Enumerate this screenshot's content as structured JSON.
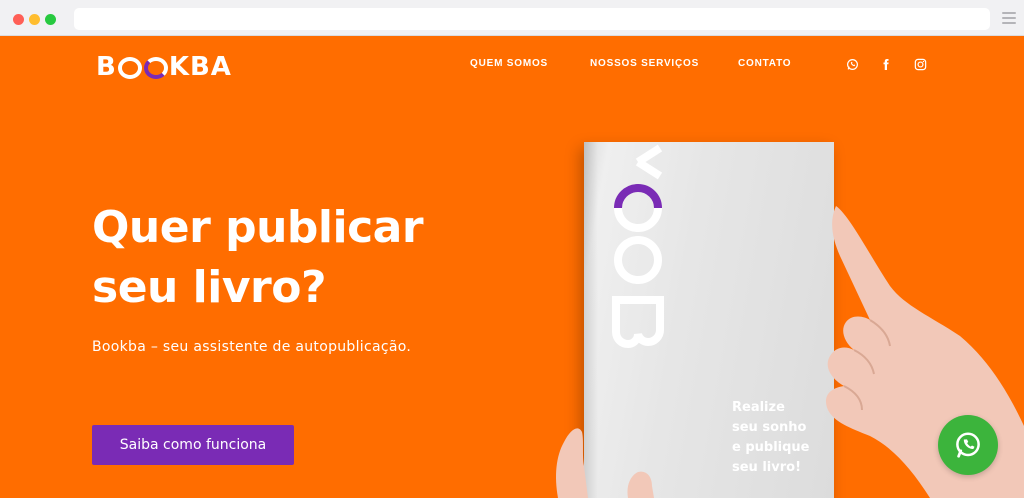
{
  "browser": {
    "url": ""
  },
  "header": {
    "logo_text": "BOOKBA",
    "nav": [
      "QUEM SOMOS",
      "NOSSOS SERVIÇOS",
      "CONTATO"
    ],
    "social_icons": [
      "whatsapp-icon",
      "facebook-icon",
      "instagram-icon"
    ]
  },
  "hero": {
    "headline_line1": "Quer publicar",
    "headline_line2": "seu livro?",
    "subtitle": "Bookba – seu assistente de autopublicação.",
    "cta_label": "Saiba como funciona"
  },
  "book": {
    "brand_fragment": "BOOK",
    "tagline": [
      "Realize",
      "seu sonho",
      "e publique",
      "seu livro!"
    ]
  },
  "floating_button": {
    "icon": "whatsapp-icon"
  },
  "colors": {
    "background": "#ff6d00",
    "accent_purple": "#7a2bb5",
    "whatsapp_green": "#3cb43c",
    "text": "#ffffff"
  }
}
